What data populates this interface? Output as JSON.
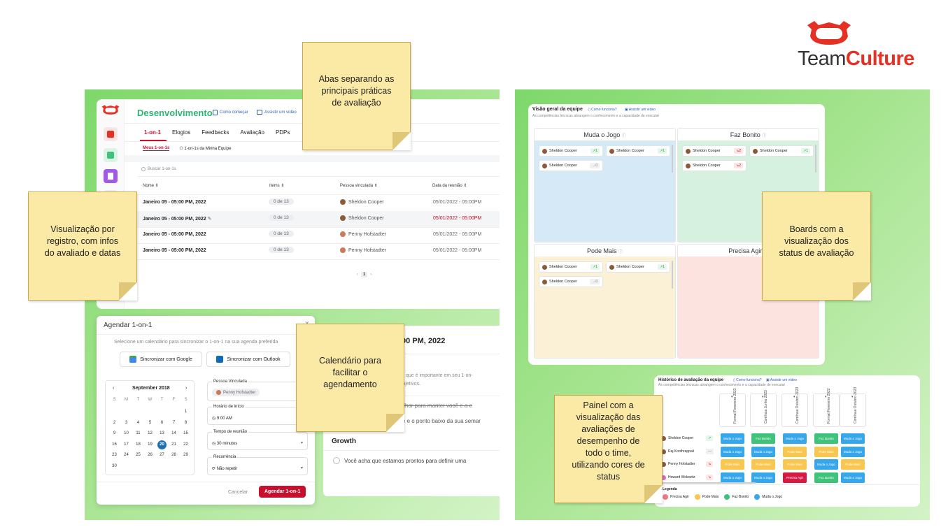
{
  "brand": {
    "team": "Team",
    "culture": "Culture",
    "color_red": "#e53024",
    "icon_name": "teamculture-logo-icon"
  },
  "notes": [
    "Abas separando as principais práticas de avaliação",
    "Visualização por registro, com infos do avaliado e datas",
    "Calendário para facilitar o agendamento",
    "Boards com a visualização dos status de avaliação",
    "Painel com a visualização das avaliações de desempenho de todo o time, utilizando cores de status"
  ],
  "left": {
    "title": "Desenvolvimento",
    "link1": "Como começar",
    "link2": "Assistir um vídeo",
    "tabs": [
      "1-on-1",
      "Elogios",
      "Feedbacks",
      "Avaliação",
      "PDPs"
    ],
    "subtabs": [
      "Meus 1-on-1s",
      "1-on-1s da Minha Equipe"
    ],
    "search_placeholder": "Buscar 1-on-1s",
    "columns": [
      "Nome",
      "Items",
      "Pessoa vinculada",
      "Data da reunião"
    ],
    "rows": [
      {
        "name": "Janeiro 05 - 05:00 PM, 2022",
        "items": "0 de 13",
        "person": "Sheldon Cooper",
        "date": "05/01/2022 - 05:00PM",
        "late": false
      },
      {
        "name": "Janeiro 05 - 05:00 PM, 2022",
        "items": "0 de 13",
        "person": "Sheldon Cooper",
        "date": "05/01/2022 - 05:00PM",
        "late": true
      },
      {
        "name": "Janeiro 05 - 05:00 PM, 2022",
        "items": "0 de 13",
        "person": "Penny Hofstadter",
        "date": "05/01/2022 - 05:00PM",
        "late": false
      },
      {
        "name": "Janeiro 05 - 05:00 PM, 2022",
        "items": "0 de 13",
        "person": "Penny Hofstadter",
        "date": "05/01/2022 - 05:00PM",
        "late": false
      }
    ],
    "page": "1"
  },
  "modal": {
    "title": "Agendar 1-on-1",
    "subtitle": "Selecione um calendário para sincronizar o 1-on-1 na sua agenda preferida",
    "google": "Sincronizar com Google",
    "outlook": "Sincronizar com Outlook",
    "month": "September 2018",
    "weekdays": [
      "S",
      "M",
      "T",
      "W",
      "T",
      "F",
      "S"
    ],
    "days": [
      [
        "",
        "",
        "",
        "",
        "",
        "",
        "1"
      ],
      [
        "2",
        "3",
        "4",
        "5",
        "6",
        "7",
        "8"
      ],
      [
        "9",
        "10",
        "11",
        "12",
        "13",
        "14",
        "15"
      ],
      [
        "16",
        "17",
        "18",
        "19",
        "20",
        "21",
        "22"
      ],
      [
        "23",
        "24",
        "25",
        "26",
        "27",
        "28",
        "29"
      ],
      [
        "30",
        "",
        "",
        "",
        "",
        "",
        ""
      ]
    ],
    "selected_day": "20",
    "f_person_label": "Pessoa Vinculada",
    "f_person_value": "Penny Hofstadter",
    "f_time_label": "Horário de início",
    "f_time_value": "9:00 AM",
    "f_duration_label": "Tempo de reunião",
    "f_duration_value": "30 minutos",
    "f_recurrence_label": "Recorrência",
    "f_recurrence_value": "Não repetir",
    "cancel": "Cancelar",
    "submit": "Agendar 1-on-1"
  },
  "behind": {
    "header": "00 PM, 2022",
    "line1": "ar o que é importante em seu 1-on-",
    "line2": "s objetivos.",
    "line3": "melhor para manter você e a e",
    "line4": "que e o ponto baixo da sua semar",
    "growth": "Growth",
    "question": "Você acha que estamos prontos para definir uma"
  },
  "boards": {
    "title": "Visão geral da equipe",
    "link1": "Como funciona?",
    "link2": "Assistir um vídeo",
    "subtitle": "As competências técnicas abrangem o conhecimento e a capacidade de executar",
    "columns": [
      {
        "title": "Muda o Jogo",
        "bg": "#d6e9f7",
        "cards": [
          {
            "name": "Sheldon Cooper",
            "tag": "1",
            "tagtype": "up"
          },
          {
            "name": "Sheldon Cooper",
            "tag": "1",
            "tagtype": "up"
          },
          {
            "name": "Sheldon Cooper",
            "tag": "0",
            "tagtype": "flat"
          }
        ]
      },
      {
        "title": "Faz Bonito",
        "bg": "#d6f1e0",
        "cards": [
          {
            "name": "Sheldon Cooper",
            "tag": "2",
            "tagtype": "down"
          },
          {
            "name": "Sheldon Cooper",
            "tag": "1",
            "tagtype": "up"
          },
          {
            "name": "Sheldon Cooper",
            "tag": "2",
            "tagtype": "down"
          }
        ]
      },
      {
        "title": "Pode Mais",
        "bg": "#fbf1d7",
        "cards": [
          {
            "name": "Sheldon Cooper",
            "tag": "1",
            "tagtype": "up"
          },
          {
            "name": "Sheldon Cooper",
            "tag": "1",
            "tagtype": "up"
          },
          {
            "name": "Sheldon Cooper",
            "tag": "0",
            "tagtype": "flat"
          }
        ]
      },
      {
        "title": "Precisa Agir",
        "bg": "#fde3df",
        "cards": []
      }
    ]
  },
  "history": {
    "title": "Histórico de avaliação da equipe",
    "link1": "Como funciona?",
    "link2": "Assistir um vídeo",
    "subtitle": "As competências técnicas abrangem o conhecimento e a capacidade de executar",
    "periods": [
      "Formal Fevereiro 2023",
      "Contínua Junho 2023",
      "Contínua Outubro 2023",
      "Formal Fevereiro 2022",
      "Contínua Outubro 2023"
    ],
    "people": [
      {
        "name": "Sheldon Cooper",
        "tag": "up",
        "cells": [
          "Muda o Jogo",
          "Faz Bonito",
          "Muda o Jogo",
          "Faz Bonito",
          "Muda o Jogo"
        ]
      },
      {
        "name": "Raj Koothrappali",
        "tag": "flat",
        "cells": [
          "Muda o Jogo",
          "Muda o Jogo",
          "Pode Mais",
          "Pode Mais",
          "Muda o Jogo"
        ]
      },
      {
        "name": "Penny Hofstadter",
        "tag": "down",
        "cells": [
          "Pode Mais",
          "Pode Mais",
          "Pode Mais",
          "Muda o Jogo",
          "Pode Mais"
        ]
      },
      {
        "name": "Howard Wolowitz",
        "tag": "down",
        "cells": [
          "Muda o Jogo",
          "Muda o Jogo",
          "Precisa Agir",
          "Faz Bonito",
          "Muda o Jogo"
        ]
      }
    ],
    "colors": {
      "Muda o Jogo": "#35a7ea",
      "Faz Bonito": "#3fc27a",
      "Pode Mais": "#f9c74f",
      "Precisa Agir": "#d51a43"
    },
    "legend_title": "Legenda",
    "legend": [
      {
        "label": "Precisa Agir",
        "color": "#f07a80"
      },
      {
        "label": "Pode Mais",
        "color": "#f9c74f"
      },
      {
        "label": "Faz Bonito",
        "color": "#3fc27a"
      },
      {
        "label": "Muda o Jogo",
        "color": "#35a7ea"
      }
    ]
  }
}
